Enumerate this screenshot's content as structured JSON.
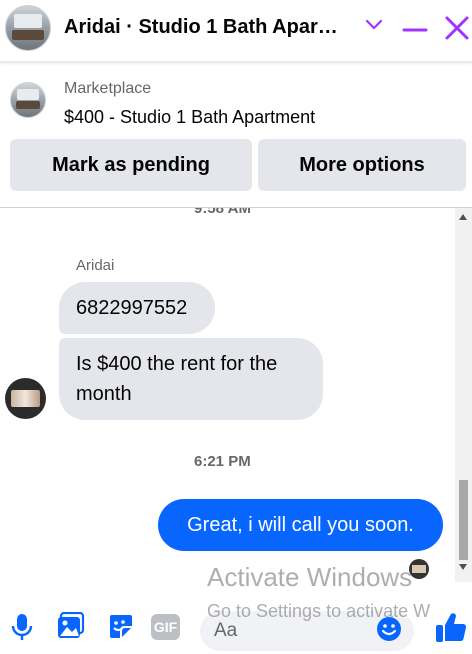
{
  "header": {
    "title": "Aridai · Studio 1 Bath Apar…",
    "icons": [
      "chevron-down-icon",
      "minimize-icon",
      "close-icon"
    ],
    "accent_color": "#a033ff"
  },
  "listing": {
    "label": "Marketplace",
    "item": "$400 - Studio 1 Bath Apartment",
    "mark_pending": "Mark as pending",
    "more_options": "More options"
  },
  "conversation": {
    "top_timestamp": "9:58 AM",
    "sender_name": "Aridai",
    "incoming": [
      "6822997552",
      "Is $400 the rent for the month"
    ],
    "mid_timestamp": "6:21 PM",
    "outgoing": [
      "Great, i will call you soon."
    ],
    "outgoing_color": "#0866ff"
  },
  "watermark": {
    "line1": "Activate Windows",
    "line2": "Go to Settings to activate W"
  },
  "composer": {
    "placeholder": "Aa",
    "gif_label": "GIF",
    "icon_color": "#0866ff"
  }
}
